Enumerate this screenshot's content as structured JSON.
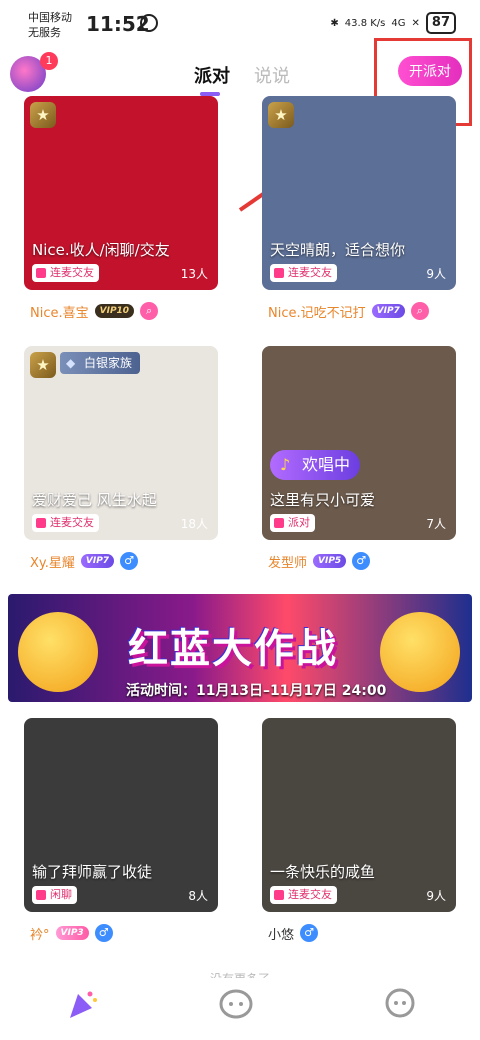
{
  "status_bar": {
    "carrier_1": "中国移动",
    "carrier_2": "无服务",
    "time": "11:52",
    "speed": "43.8 K/s",
    "network": "4G",
    "battery": "87"
  },
  "header": {
    "avatar_badge": "1",
    "tabs": [
      {
        "label": "派对",
        "active": true
      },
      {
        "label": "说说",
        "active": false
      }
    ],
    "open_party_label": "开派对"
  },
  "rooms": [
    {
      "title": "Nice.收人/闲聊/交友",
      "tag": "连麦交友",
      "count": "13人",
      "host": "Nice.喜宝",
      "vip": "VIP10",
      "host_color": "#e8862c",
      "bg": "#c2122c",
      "rank_icon": true,
      "family": "",
      "status_badge": ""
    },
    {
      "title": "天空晴朗，适合想你",
      "tag": "连麦交友",
      "count": "9人",
      "host": "Nice.记吃不记打",
      "vip": "VIP7",
      "host_color": "#e8862c",
      "bg": "#5c6f96",
      "rank_icon": true,
      "family": "",
      "status_badge": ""
    },
    {
      "title": "爱财爱己 风生水起",
      "tag": "连麦交友",
      "count": "18人",
      "host": "Xy.星耀",
      "vip": "VIP7",
      "host_color": "#e8862c",
      "bg": "#e9e5df",
      "rank_icon": true,
      "family": "白银家族",
      "status_badge": ""
    },
    {
      "title": "这里有只小可爱",
      "tag": "派对",
      "count": "7人",
      "host": "发型师",
      "vip": "VIP5",
      "host_color": "#e8862c",
      "bg": "#6c5a4c",
      "rank_icon": false,
      "family": "",
      "status_badge": "欢唱中"
    },
    {
      "title": "输了拜师赢了收徒",
      "tag": "闲聊",
      "count": "8人",
      "host": "衿°",
      "vip": "VIP3",
      "host_color": "#e8862c",
      "bg": "#3b3b3b",
      "rank_icon": false,
      "family": "",
      "status_badge": ""
    },
    {
      "title": "一条快乐的咸鱼",
      "tag": "连麦交友",
      "count": "9人",
      "host": "小悠",
      "vip": "",
      "host_color": "#333333",
      "bg": "#4a4640",
      "rank_icon": false,
      "family": "",
      "status_badge": ""
    }
  ],
  "banner": {
    "title": "红蓝大作战",
    "date_text": "活动时间：11月13日–11月17日 24:00"
  },
  "bottom_hint": "没有更多了",
  "nav": [
    {
      "icon": "party-popper-icon"
    },
    {
      "icon": "chat-bubbles-icon"
    },
    {
      "icon": "message-icon"
    }
  ],
  "colors": {
    "accent_purple": "#8b5cf6",
    "open_party_pink": "#ff4fd1",
    "annotation_red": "#e53935"
  }
}
